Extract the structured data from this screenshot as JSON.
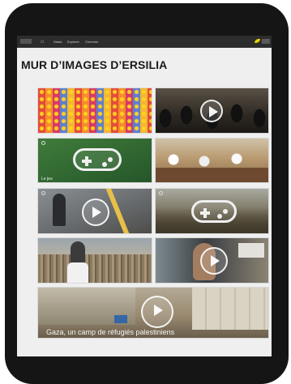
{
  "topbar": {
    "home_icon": "home-icon",
    "links": [
      "Statut",
      "Explorer",
      "Chercher"
    ],
    "user_icon": "user-icon",
    "brand_icon": "leaf-icon"
  },
  "page": {
    "title": "MUR D’IMAGES D’ERSILIA"
  },
  "tiles": [
    {
      "name": "tile-mosaic",
      "kind": "image",
      "colors": [
        "#e0443a",
        "#f0962e",
        "#4b7ac6"
      ]
    },
    {
      "name": "tile-crowd-video",
      "kind": "video",
      "caption": ""
    },
    {
      "name": "tile-game-green",
      "kind": "game",
      "caption": "Le jeu"
    },
    {
      "name": "tile-kitchen",
      "kind": "image",
      "caption": ""
    },
    {
      "name": "tile-street-video",
      "kind": "video",
      "caption": ""
    },
    {
      "name": "tile-game-forest",
      "kind": "game",
      "caption": ""
    },
    {
      "name": "tile-festival",
      "kind": "image",
      "caption": ""
    },
    {
      "name": "tile-interview-video",
      "kind": "video",
      "caption": ""
    },
    {
      "name": "tile-camp-video",
      "kind": "video",
      "caption": "Gaza, un camp de réfugiés palestiniens"
    }
  ]
}
